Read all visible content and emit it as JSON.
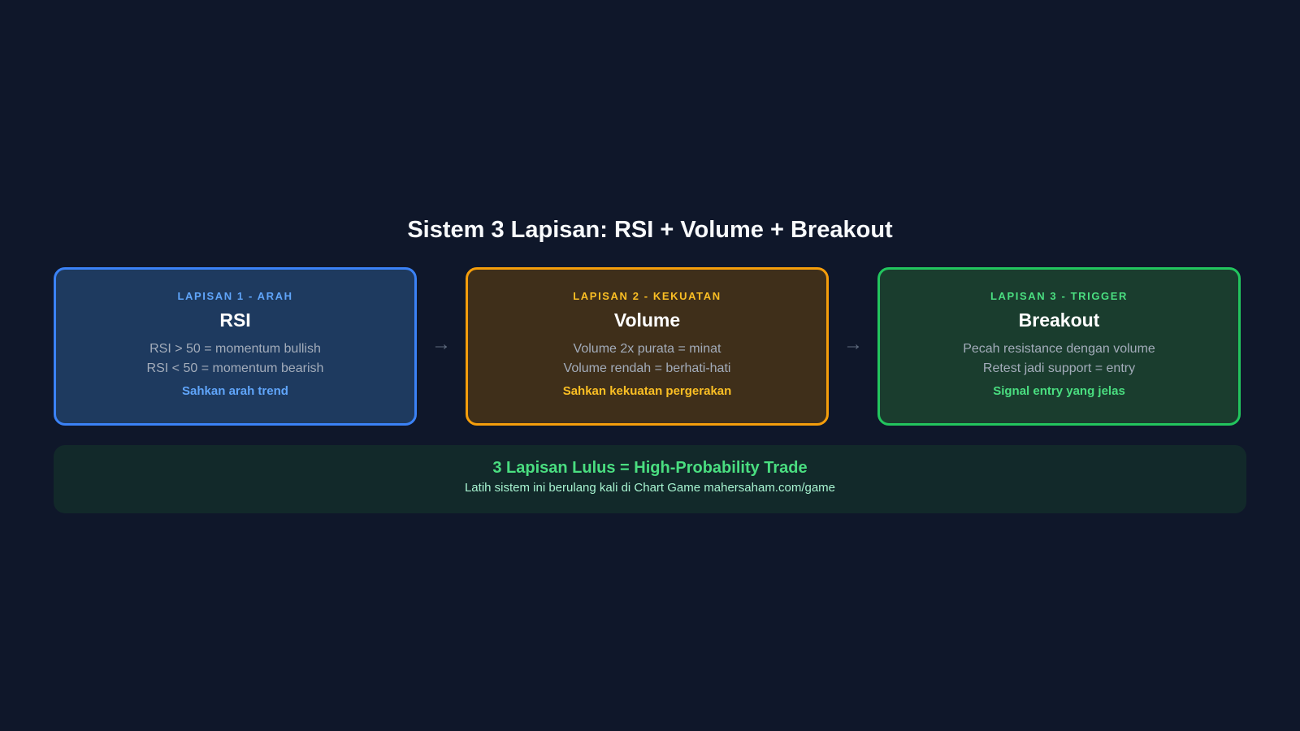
{
  "title": "Sistem 3 Lapisan: RSI + Volume + Breakout",
  "layers": [
    {
      "label": "LAPISAN 1 - ARAH",
      "name": "RSI",
      "lines": [
        "RSI > 50 = momentum bullish",
        "RSI < 50 = momentum bearish"
      ],
      "note": "Sahkan arah trend",
      "accent": "#3b82f6"
    },
    {
      "label": "LAPISAN 2 - KEKUATAN",
      "name": "Volume",
      "lines": [
        "Volume 2x purata = minat",
        "Volume rendah = berhati-hati"
      ],
      "note": "Sahkan kekuatan pergerakan",
      "accent": "#f59e0b"
    },
    {
      "label": "LAPISAN 3 - TRIGGER",
      "name": "Breakout",
      "lines": [
        "Pecah resistance dengan volume",
        "Retest jadi support = entry"
      ],
      "note": "Signal entry yang jelas",
      "accent": "#22c55e"
    }
  ],
  "arrow_glyph": "→",
  "summary": {
    "headline": "3 Lapisan Lulus = High-Probability Trade",
    "subtext": "Latih sistem ini berulang kali di Chart Game mahersaham.com/game"
  },
  "colors": {
    "background": "#0f172a",
    "blue": "#60a5fa",
    "amber": "#fbbf24",
    "green": "#4ade80"
  }
}
